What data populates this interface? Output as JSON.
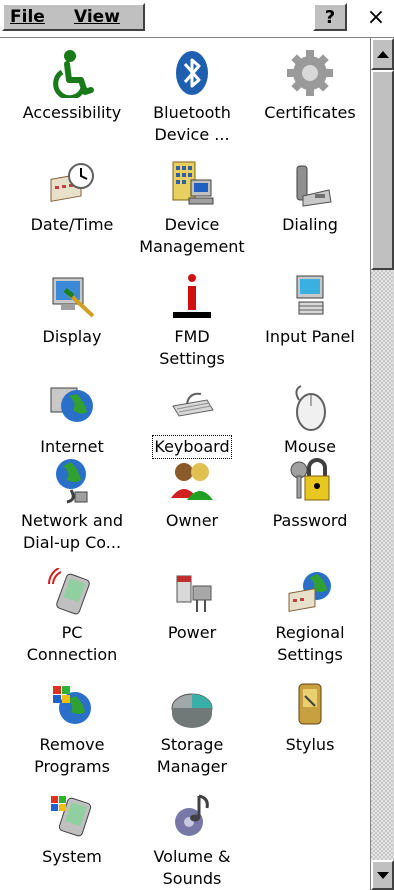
{
  "menubar": {
    "file_label": "File",
    "view_label": "View",
    "help_label": "?",
    "close_label": "×"
  },
  "items": [
    {
      "label": "Accessibility",
      "icon": "accessibility-icon"
    },
    {
      "label": "Bluetooth Device ...",
      "icon": "bluetooth-icon"
    },
    {
      "label": "Certificates",
      "icon": "certificates-icon"
    },
    {
      "label": "Date/Time",
      "icon": "date-time-icon"
    },
    {
      "label": "Device Management",
      "icon": "device-management-icon"
    },
    {
      "label": "Dialing",
      "icon": "dialing-icon"
    },
    {
      "label": "Display",
      "icon": "display-icon"
    },
    {
      "label": "FMD Settings",
      "icon": "fmd-settings-icon"
    },
    {
      "label": "Input Panel",
      "icon": "input-panel-icon"
    },
    {
      "label": "Internet",
      "icon": "internet-icon"
    },
    {
      "label": "Keyboard",
      "icon": "keyboard-icon"
    },
    {
      "label": "Mouse",
      "icon": "mouse-icon"
    },
    {
      "label": "Network and Dial-up Co...",
      "icon": "network-icon"
    },
    {
      "label": "Owner",
      "icon": "owner-icon"
    },
    {
      "label": "Password",
      "icon": "password-icon"
    },
    {
      "label": "PC Connection",
      "icon": "pc-connection-icon"
    },
    {
      "label": "Power",
      "icon": "power-icon"
    },
    {
      "label": "Regional Settings",
      "icon": "regional-settings-icon"
    },
    {
      "label": "Remove Programs",
      "icon": "remove-programs-icon"
    },
    {
      "label": "Storage Manager",
      "icon": "storage-manager-icon"
    },
    {
      "label": "Stylus",
      "icon": "stylus-icon"
    },
    {
      "label": "System",
      "icon": "system-icon"
    },
    {
      "label": "Volume & Sounds",
      "icon": "volume-sounds-icon"
    }
  ],
  "colors": {
    "chrome": "#c0c0c0",
    "focus_outline": "#000000"
  }
}
